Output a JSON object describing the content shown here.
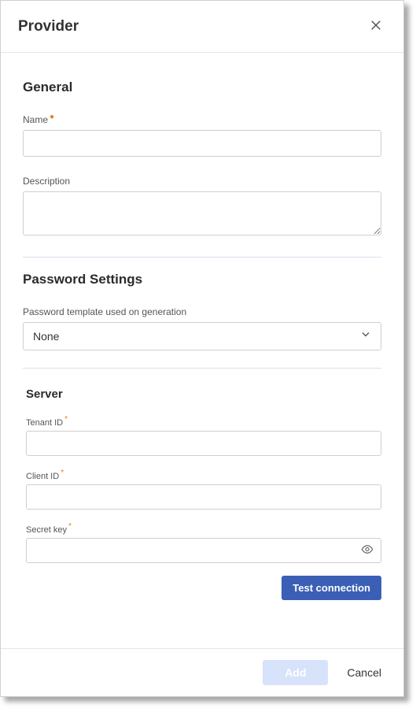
{
  "dialog": {
    "title": "Provider"
  },
  "general": {
    "heading": "General",
    "name_label": "Name",
    "name_value": "",
    "description_label": "Description",
    "description_value": ""
  },
  "password": {
    "heading": "Password Settings",
    "template_label": "Password template used on generation",
    "template_selected": "None",
    "template_options": [
      "None"
    ]
  },
  "server": {
    "heading": "Server",
    "tenant_label": "Tenant ID",
    "tenant_value": "",
    "client_label": "Client ID",
    "client_value": "",
    "secret_label": "Secret key",
    "secret_value": "",
    "test_button": "Test connection"
  },
  "footer": {
    "add": "Add",
    "cancel": "Cancel"
  }
}
